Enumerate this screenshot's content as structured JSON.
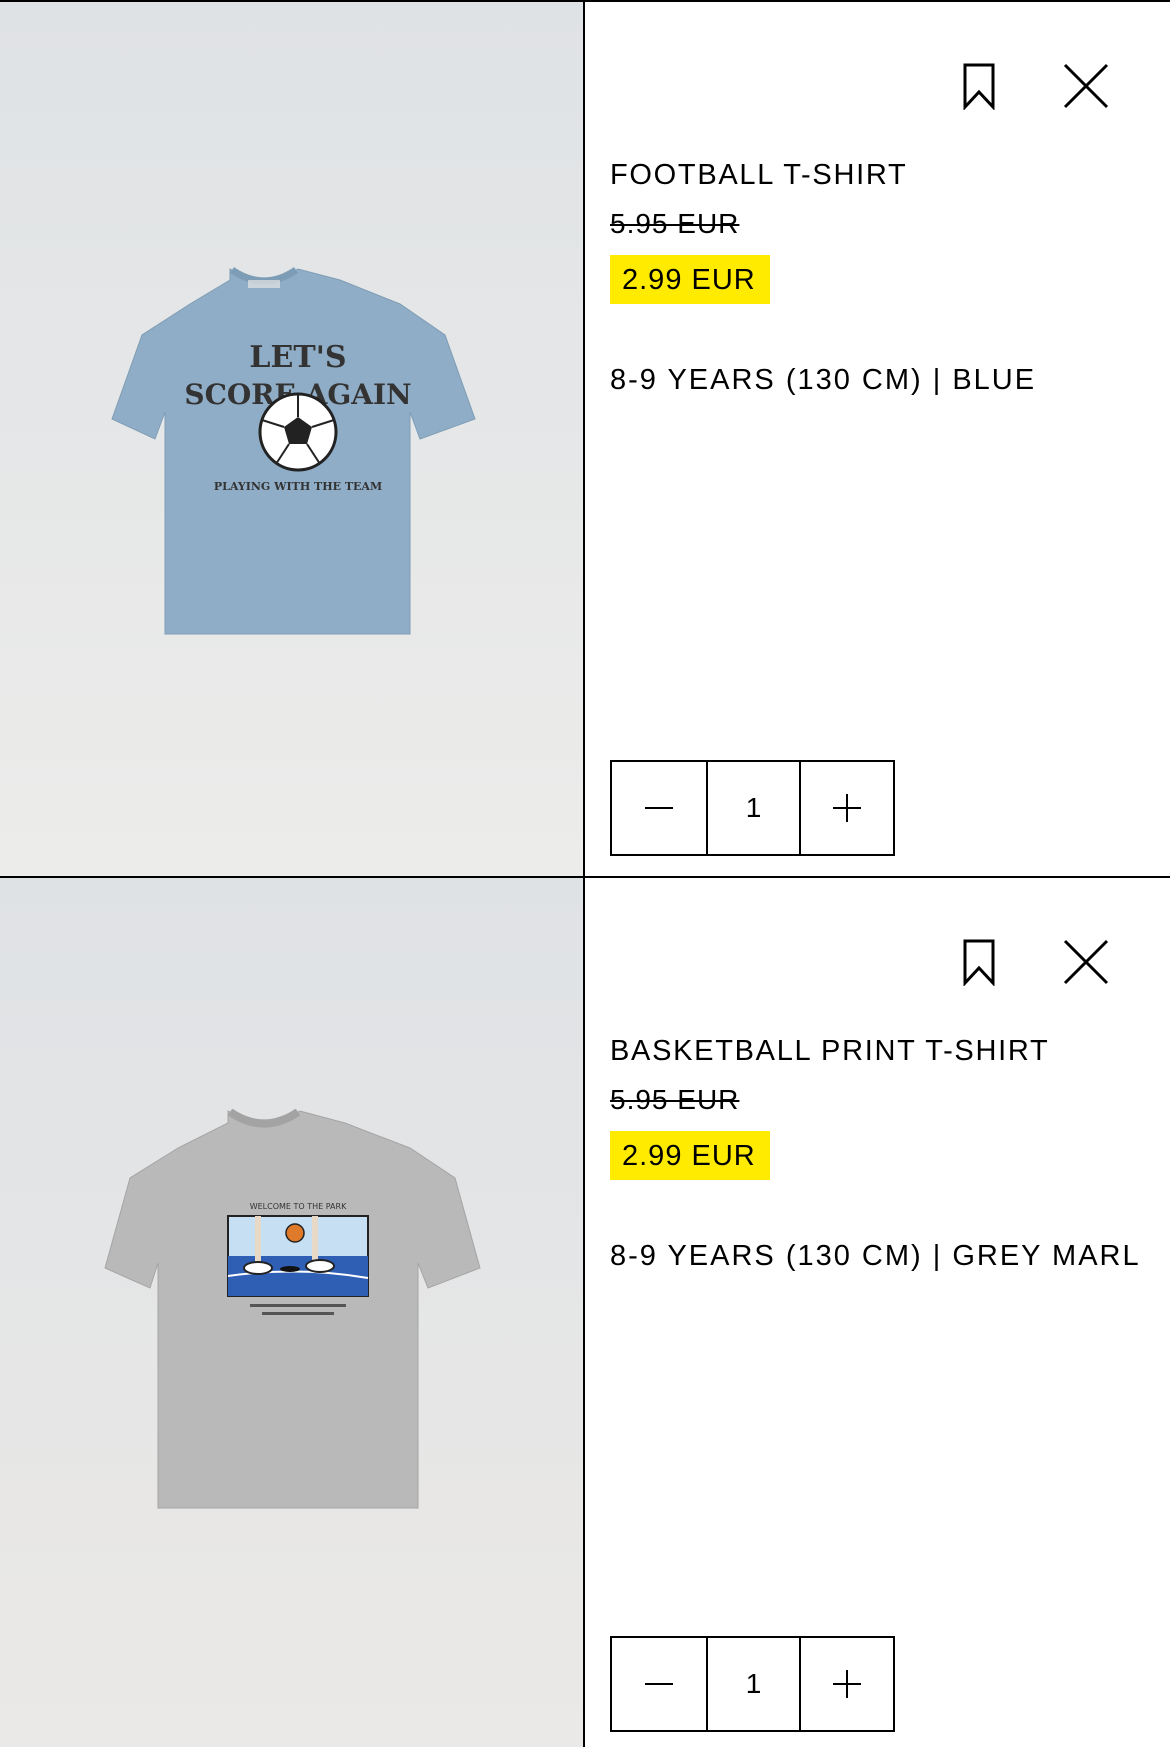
{
  "items": [
    {
      "name": "FOOTBALL T-SHIRT",
      "original_price": "5.95 EUR",
      "sale_price": "2.99 EUR",
      "variant": "8-9 YEARS (130 CM) | BLUE",
      "quantity": "1",
      "shirt_color": "#8fadc6",
      "print_text": [
        "LET'S",
        "SCORE AGAIN",
        "PLAYING WITH THE TEAM"
      ]
    },
    {
      "name": "BASKETBALL PRINT T-SHIRT",
      "original_price": "5.95 EUR",
      "sale_price": "2.99 EUR",
      "variant": "8-9 YEARS (130 CM) | GREY MARL",
      "quantity": "1",
      "shirt_color": "#b9b9b9",
      "print_text": [
        "WELCOME TO THE PARK"
      ]
    }
  ],
  "icons": {
    "bookmark": "bookmark-icon",
    "close": "close-icon",
    "minus": "minus-icon",
    "plus": "plus-icon"
  },
  "colors": {
    "sale_highlight": "#ffeb00",
    "border": "#000000"
  }
}
